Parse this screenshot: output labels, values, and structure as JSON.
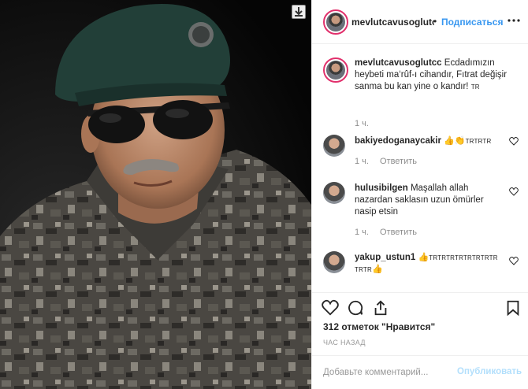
{
  "post": {
    "author": "mevlutcavusoglutcc",
    "follow_label": "Подписаться",
    "header_separator": "•"
  },
  "caption": {
    "username": "mevlutcavusoglutcc",
    "text": "Ecdadımızın heybeti ma‘rûf-ı cihandır, Fıtrat değişir sanma bu kan yine o kandır!",
    "flag": "TR",
    "time": "1 ч."
  },
  "comments": [
    {
      "username": "bakiyedoganaycakir",
      "emoji": "👍👏",
      "text": "TRTRTR",
      "time": "1 ч.",
      "reply": "Ответить"
    },
    {
      "username": "hulusibilgen",
      "text": "Maşallah allah nazardan saklasın uzun ömürler nasip etsin",
      "time": "1 ч.",
      "reply": "Ответить"
    },
    {
      "username": "yakup_ustun1",
      "emoji_a": "👍",
      "text_a": "TRTRTRTRTRTRTRTR",
      "text_b": "TRTR",
      "emoji_b": "👍"
    }
  ],
  "likes": "312 отметок \"Нравится\"",
  "posted_ago": "ЧАС НАЗАД",
  "add_comment": {
    "placeholder": "Добавьте комментарий...",
    "publish_label": "Опубликовать"
  },
  "icons": [
    "download-icon",
    "more-icon",
    "heart-icon",
    "comment-icon",
    "share-icon",
    "bookmark-icon"
  ],
  "colors": {
    "accent": "#3897f0",
    "publish_disabled": "#b2dffc",
    "meta": "#8e8e8e",
    "story_ring": "#e1306c"
  }
}
